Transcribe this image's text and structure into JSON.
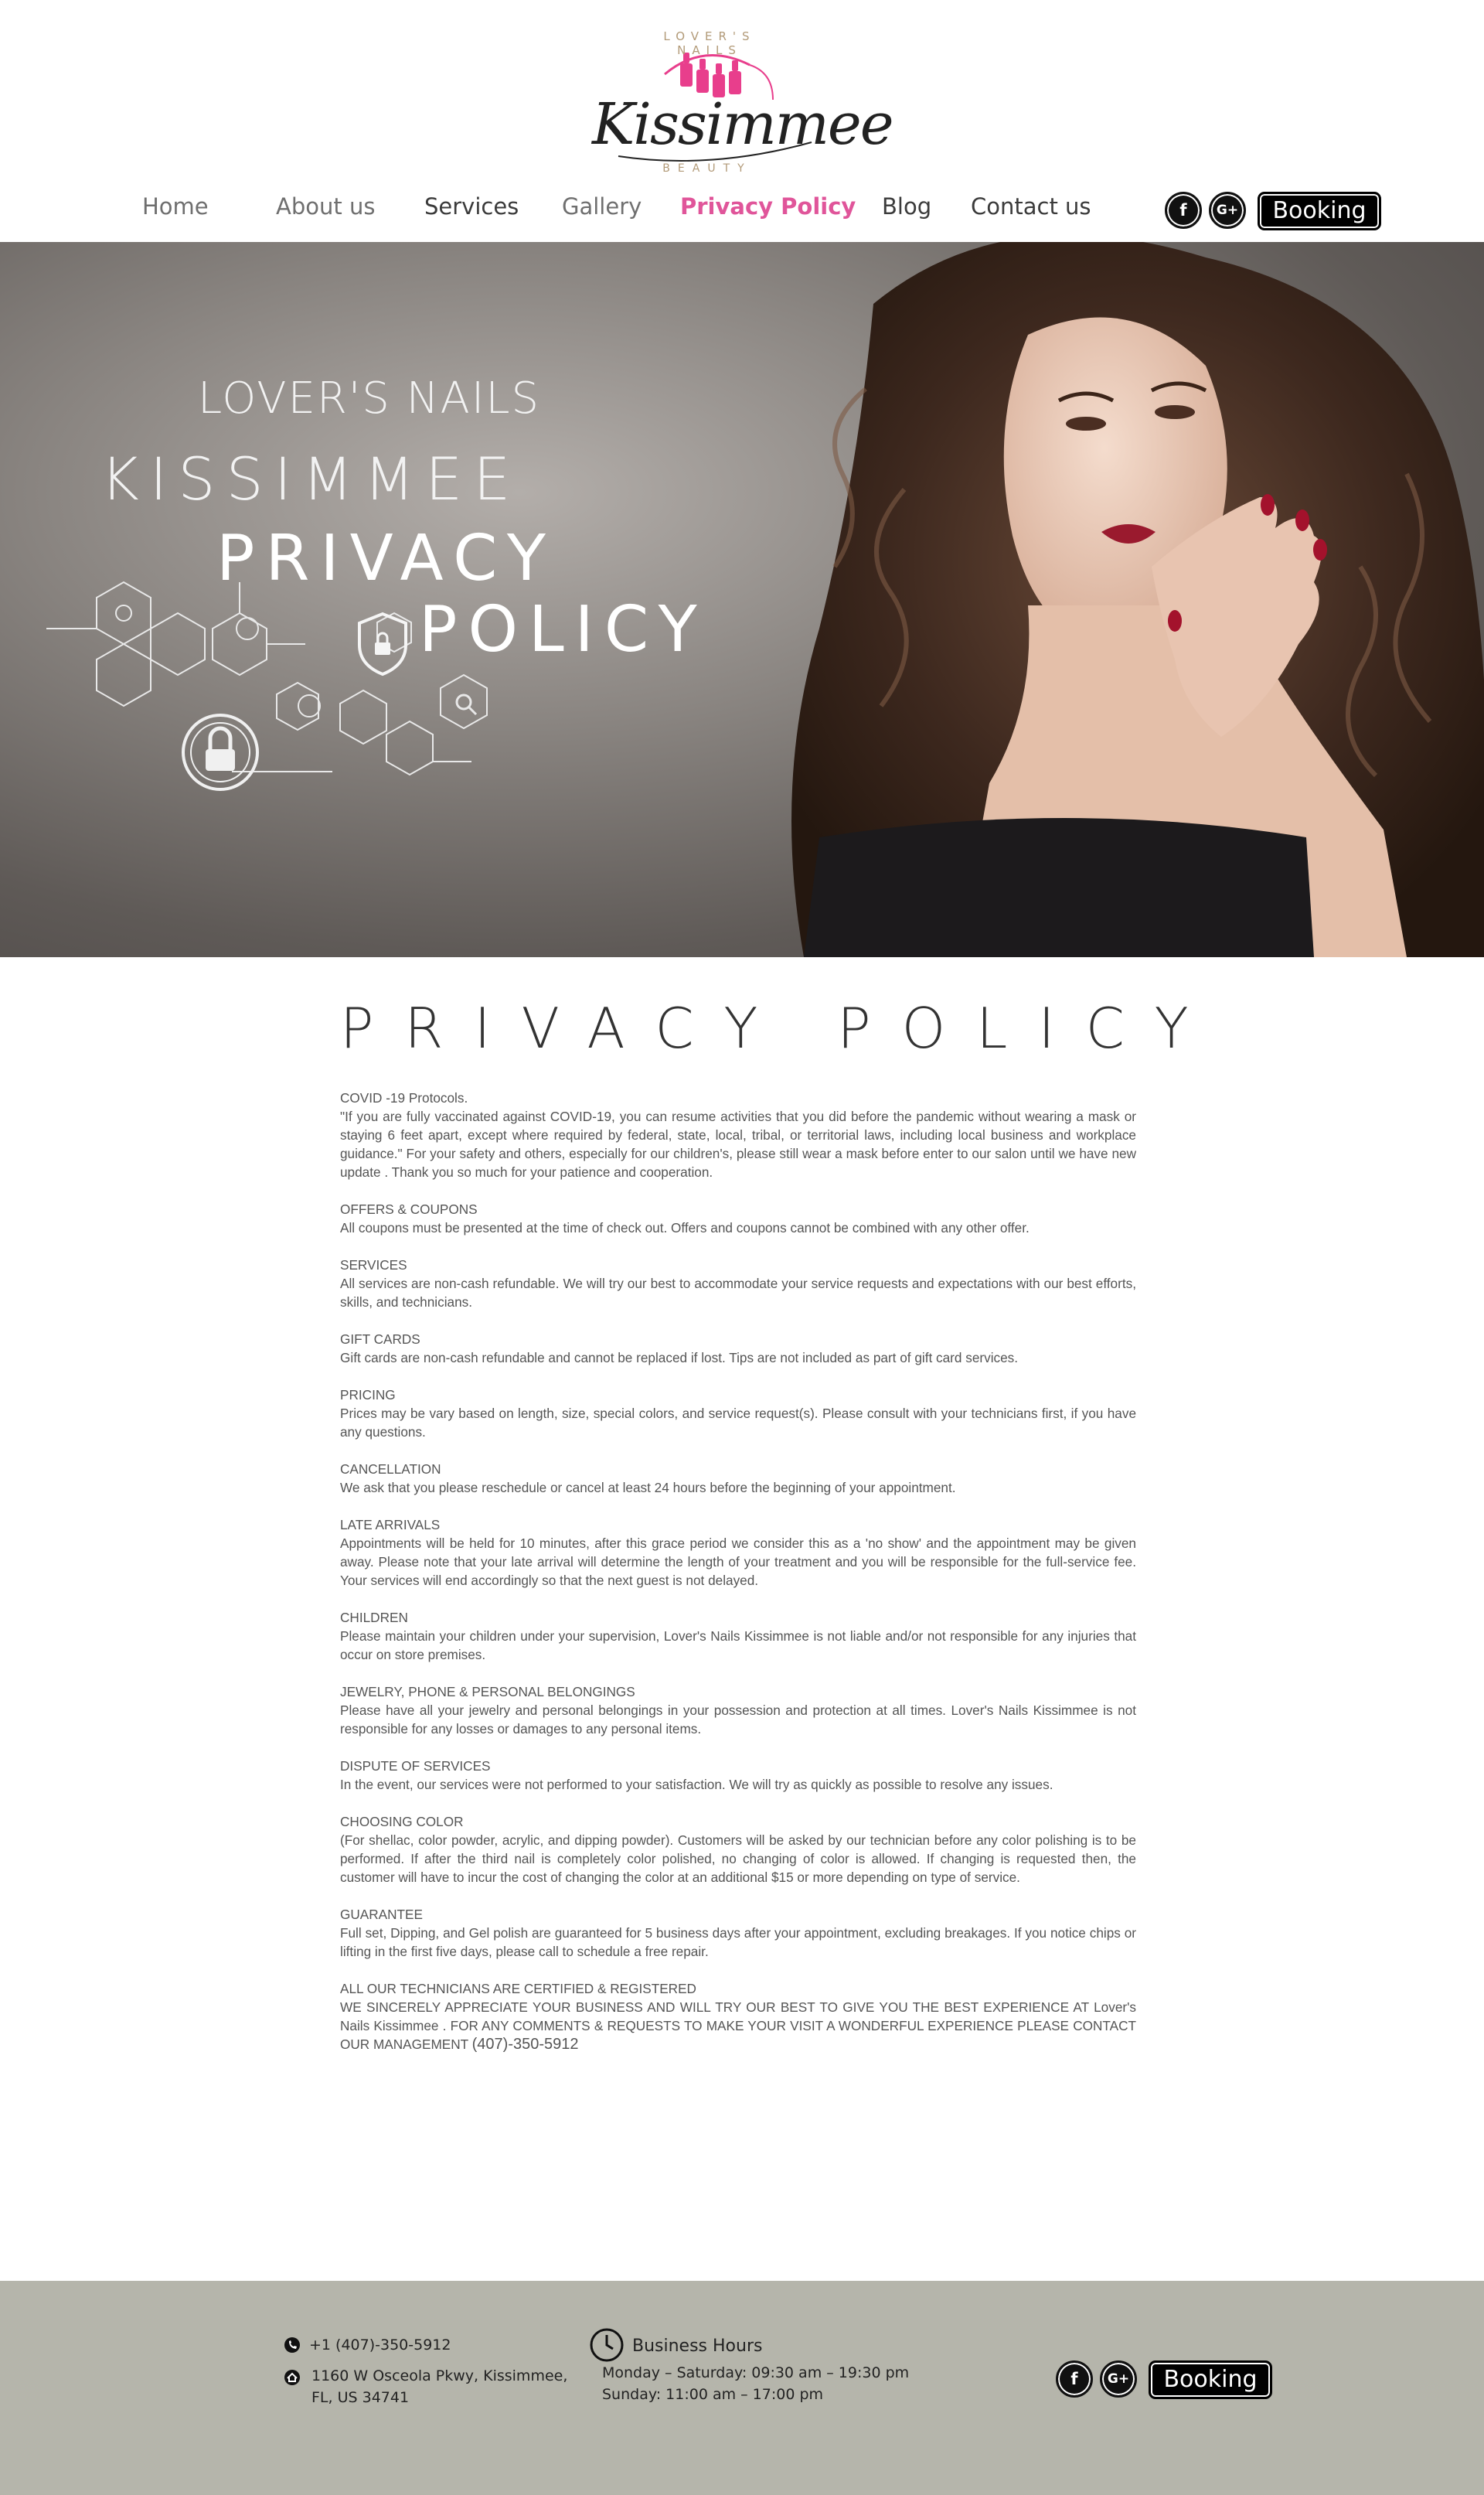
{
  "brand": {
    "arc_text": "LOVER'S NAILS",
    "script_name": "Kissimmee",
    "tagline": "BEAUTY"
  },
  "nav": {
    "items": [
      {
        "label": "Home"
      },
      {
        "label": "About us"
      },
      {
        "label": "Services"
      },
      {
        "label": "Gallery"
      },
      {
        "label": "Privacy Policy"
      },
      {
        "label": "Blog"
      },
      {
        "label": "Contact us"
      }
    ],
    "active": "Privacy Policy",
    "facebook": "f",
    "google": "G+",
    "booking": "Booking"
  },
  "hero": {
    "line1": "LOVER'S NAILS",
    "line2": "KISSIMMEE",
    "line3": "PRIVACY",
    "line4": "POLICY"
  },
  "page_title": "PRIVACY POLICY",
  "policy": [
    {
      "head": "COVID -19 Protocols.",
      "body": "\"If you are fully vaccinated against COVID-19, you can resume activities that you did before the pandemic without wearing a mask or staying 6 feet apart, except where required by federal, state, local, tribal, or territorial laws, including local business and workplace guidance.\" For your safety and others, especially for our children's, please still wear a mask before enter to our salon until we have new update . Thank you so much for your patience and cooperation."
    },
    {
      "head": "OFFERS & COUPONS",
      "body": "All coupons must be presented at the time of check out. Offers and coupons cannot be combined with any other offer."
    },
    {
      "head": "SERVICES",
      "body": "All services are non-cash refundable. We will try our best to accommodate your service requests and expectations with our best efforts, skills, and technicians."
    },
    {
      "head": "GIFT CARDS",
      "body": "Gift cards are non-cash refundable and cannot be replaced if lost. Tips are not included as part of gift card services."
    },
    {
      "head": "PRICING",
      "body": "Prices may be vary based on length, size, special colors, and service request(s). Please consult with your technicians first, if you have any questions."
    },
    {
      "head": "CANCELLATION",
      "body": "We ask that you please reschedule or cancel at least 24 hours before the beginning of your appointment."
    },
    {
      "head": "LATE ARRIVALS",
      "body": "Appointments will be held for 10 minutes, after this grace period we consider this as a 'no show' and the appointment may be given away. Please note that your late arrival will determine the length of your treatment and you will be responsible for the full-service fee. Your services will end accordingly so that the next guest is not delayed."
    },
    {
      "head": "CHILDREN",
      "body": "Please maintain your children under your supervision, Lover's Nails Kissimmee  is not liable and/or not responsible for any injuries that occur on store premises."
    },
    {
      "head": "JEWELRY, PHONE & PERSONAL BELONGINGS",
      "body": "Please have all your jewelry and personal belongings in your possession and protection at all times. Lover's Nails Kissimmee  is not responsible for any losses or damages to any personal items."
    },
    {
      "head": "DISPUTE OF SERVICES",
      "body": "In the event, our services were not performed to your satisfaction. We will try as quickly as possible to resolve any issues."
    },
    {
      "head": "CHOOSING COLOR",
      "body": "(For shellac, color powder, acrylic, and dipping powder). Customers will be asked by our technician before any color polishing is to be performed. If after the third nail is completely color polished, no changing of color is allowed. If changing is requested then, the customer will have to incur the cost of changing the color at an additional $15 or more depending on type of service."
    },
    {
      "head": "GUARANTEE",
      "body": "Full set, Dipping, and Gel polish are guaranteed for 5 business days after your appointment, excluding breakages. If you notice chips or lifting in the first five days, please call to schedule a free repair."
    }
  ],
  "closing": {
    "head": "ALL OUR TECHNICIANS ARE CERTIFIED & REGISTERED",
    "body": "WE SINCERELY APPRECIATE YOUR BUSINESS AND WILL TRY OUR BEST TO GIVE YOU THE BEST EXPERIENCE AT Lover's Nails Kissimmee . FOR ANY COMMENTS & REQUESTS TO MAKE YOUR VISIT A WONDERFUL EXPERIENCE PLEASE CONTACT OUR MANAGEMENT",
    "phone": "(407)-350-5912"
  },
  "footer": {
    "phone": "+1 (407)-350-5912",
    "address_line1": "1160 W Osceola Pkwy, Kissimmee,",
    "address_line2": "FL, US 34741",
    "hours_title": "Business Hours",
    "hours_weekday": "Monday – Saturday: 09:30 am – 19:30 pm",
    "hours_sunday": "Sunday: 11:00 am – 17:00 pm",
    "facebook": "f",
    "google": "G+",
    "booking": "Booking"
  },
  "colors": {
    "accent_pink": "#e0559a",
    "footer_bg": "#b5b5ab",
    "button_bg": "#000000"
  }
}
